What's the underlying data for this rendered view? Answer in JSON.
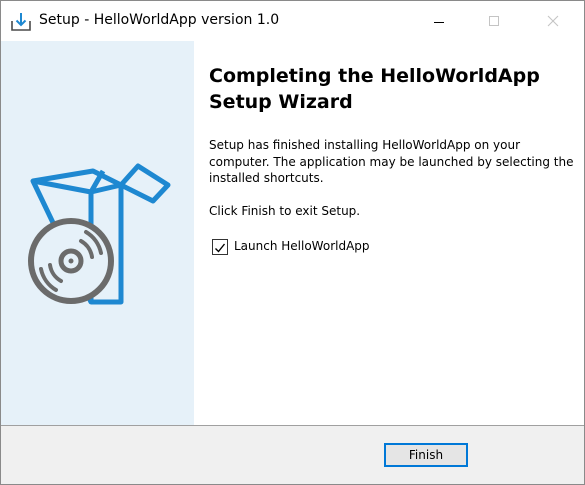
{
  "window": {
    "title": "Setup - HelloWorldApp version 1.0",
    "icon": "setup-download-icon"
  },
  "controls": {
    "minimize_icon": "minimize-icon",
    "maximize_icon": "maximize-icon",
    "close_icon": "close-icon"
  },
  "side_panel": {
    "graphic": "box-with-disc-icon",
    "background": "#e6f1f9",
    "accent": "#1e88d1"
  },
  "content": {
    "heading": "Completing the HelloWorldApp Setup Wizard",
    "paragraph1": "Setup has finished installing HelloWorldApp on your computer. The application may be launched by selecting the installed shortcuts.",
    "paragraph2": "Click Finish to exit Setup.",
    "launch_checkbox": {
      "label": "Launch HelloWorldApp",
      "checked": true
    }
  },
  "footer": {
    "finish_label": "Finish",
    "focus_color": "#0078d7"
  }
}
